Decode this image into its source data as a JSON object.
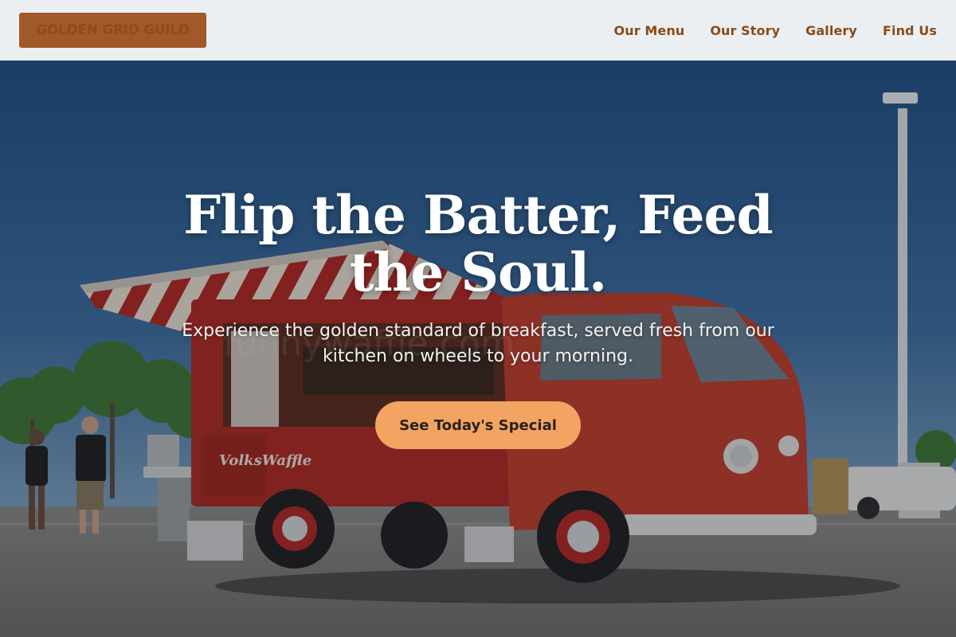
{
  "header": {
    "logo_text": "GOLDEN GRID GUILD",
    "nav": [
      {
        "label": "Our Menu"
      },
      {
        "label": "Our Story"
      },
      {
        "label": "Gallery"
      },
      {
        "label": "Find Us"
      }
    ]
  },
  "hero": {
    "title": "Flip the Batter, Feed the Soul.",
    "subtitle": "Experience the golden standard of breakfast, served fresh from our kitchen on wheels to your morning.",
    "cta_label": "See Today's Special",
    "image_text": "VolksWaffle",
    "image_watermark": "funnywaffle.com"
  },
  "colors": {
    "header_bg": "#eceff1",
    "logo_bg": "#a2592a",
    "nav_text": "#8a4a17",
    "cta_bg": "#f3a462",
    "hero_text": "#ffffff"
  }
}
